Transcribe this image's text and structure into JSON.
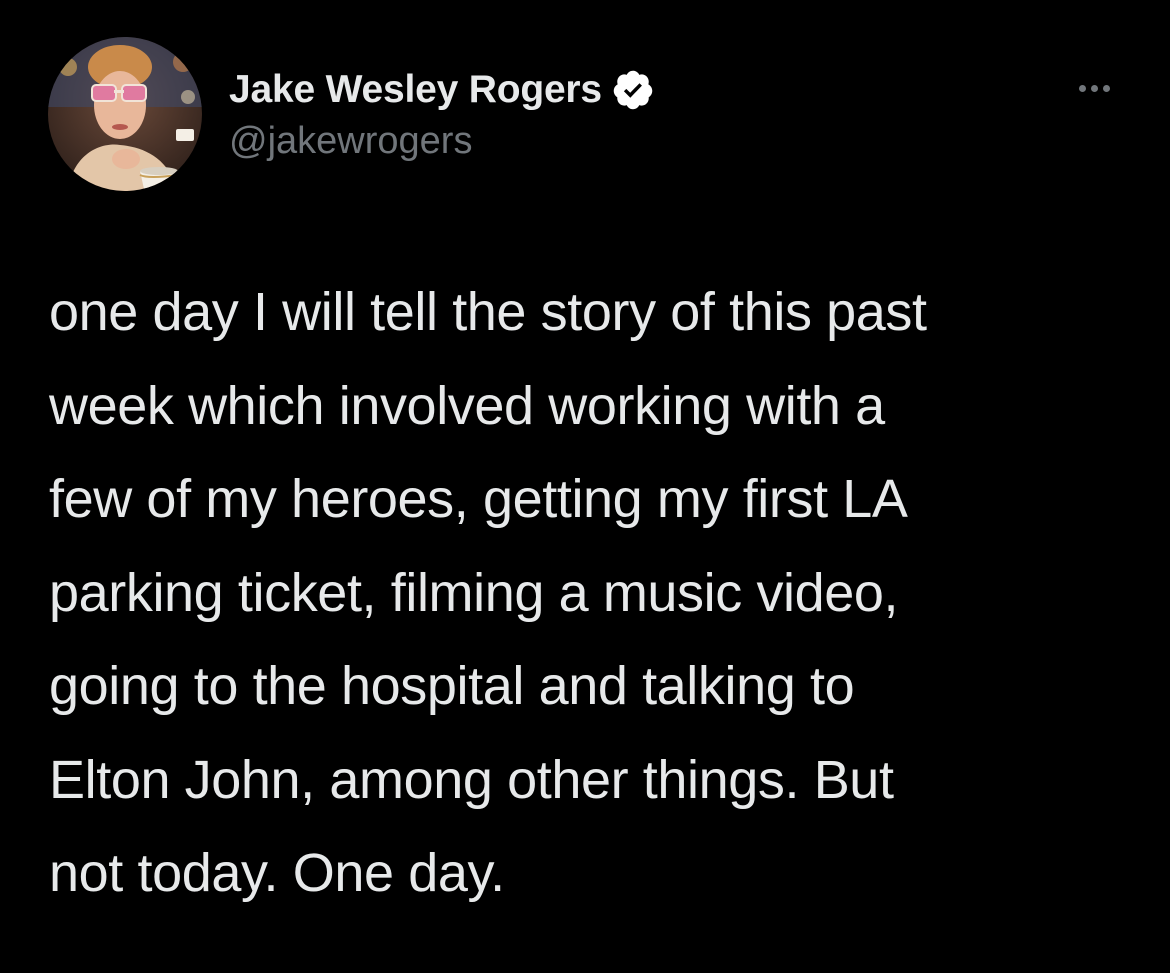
{
  "tweet": {
    "author": {
      "display_name": "Jake Wesley Rogers",
      "handle": "@jakewrogers",
      "verified": true,
      "avatar_icon": "profile-photo"
    },
    "more_icon": "more-options-icon",
    "text_lines": [
      "one day I will tell the story of this past",
      "week which involved working with a",
      "few of my heroes, getting my first LA",
      "parking ticket, filming a music video,",
      "going to the hospital and talking to",
      "Elton John, among other things. But",
      "not today. One day."
    ]
  },
  "colors": {
    "background": "#000000",
    "primary_text": "#e7e9ea",
    "secondary_text": "#71767b",
    "verified_badge": "#ffffff"
  }
}
